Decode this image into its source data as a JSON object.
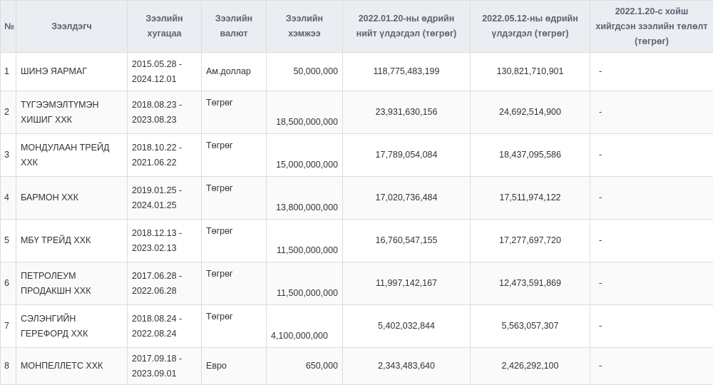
{
  "headers": {
    "no": "№",
    "borrower": "Зээлдэгч",
    "term": "Зээлийн хугацаа",
    "currency": "Зээлийн валют",
    "amount": "Зээлийн хэмжээ",
    "balance_jan": "2022.01.20-ны өдрийн нийт үлдэгдэл (төгрөг)",
    "balance_may": "2022.05.12-ны өдрийн үлдэгдэл (төгрөг)",
    "repayment": "2022.1.20-с хойш хийгдсэн зээлийн төлөлт (төгрөг)"
  },
  "rows": [
    {
      "no": "1",
      "borrower": "ШИНЭ ЯАРМАГ",
      "term": "2015.05.28 - 2024.12.01",
      "currency": "Ам.доллар",
      "amount": "50,000,000",
      "balance_jan": "118,775,483,199",
      "balance_may": "130,821,710,901",
      "repayment": "-"
    },
    {
      "no": "2",
      "borrower": "ТҮГЭЭМЭЛТҮМЭН ХИШИГ ХХК",
      "term": "2018.08.23 - 2023.08.23",
      "currency": "Төгрөг",
      "amount": "18,500,000,000",
      "balance_jan": "23,931,630,156",
      "balance_may": "24,692,514,900",
      "repayment": "-"
    },
    {
      "no": "3",
      "borrower": "МОНДУЛААН ТРЕЙД ХХК",
      "term": "2018.10.22 - 2021.06.22",
      "currency": "Төгрөг",
      "amount": "15,000,000,000",
      "balance_jan": "17,789,054,084",
      "balance_may": "18,437,095,586",
      "repayment": "-"
    },
    {
      "no": "4",
      "borrower": "БАРМОН ХХК",
      "term": "2019.01.25 - 2024.01.25",
      "currency": "Төгрөг",
      "amount": "13,800,000,000",
      "balance_jan": "17,020,736,484",
      "balance_may": "17,511,974,122",
      "repayment": "-"
    },
    {
      "no": "5",
      "borrower": "МБҮ ТРЕЙД ХХК",
      "term": "2018.12.13 - 2023.02.13",
      "currency": "Төгрөг",
      "amount": "11,500,000,000",
      "balance_jan": "16,760,547,155",
      "balance_may": "17,277,697,720",
      "repayment": "-"
    },
    {
      "no": "6",
      "borrower": "ПЕТРОЛЕУМ ПРОДАКШН ХХК",
      "term": "2017.06.28 - 2022.06.28",
      "currency": "Төгрөг",
      "amount": "11,500,000,000",
      "balance_jan": "11,997,142,167",
      "balance_may": "12,473,591,869",
      "repayment": "-"
    },
    {
      "no": "7",
      "borrower": "СЭЛЭНГИЙН ГЕРЕФОРД ХХК",
      "term": "2018.08.24 - 2022.08.24",
      "currency": "Төгрөг",
      "amount": "4,100,000,000",
      "balance_jan": "5,402,032,844",
      "balance_may": "5,563,057,307",
      "repayment": "-"
    },
    {
      "no": "8",
      "borrower": "МОНПЕЛЛЕТС ХХК",
      "term": "2017.09.18 - 2023.09.01",
      "currency": "Евро",
      "amount": "650,000",
      "balance_jan": "2,343,483,640",
      "balance_may": "2,426,292,100",
      "repayment": "-"
    }
  ]
}
